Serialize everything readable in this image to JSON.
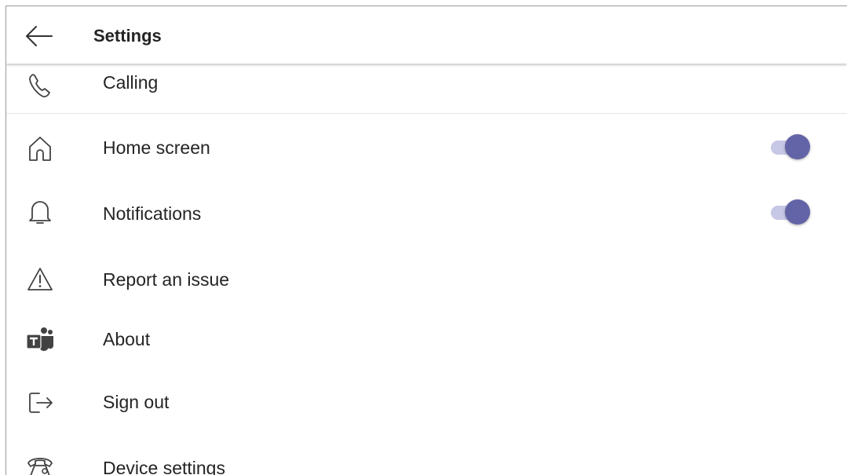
{
  "header": {
    "title": "Settings",
    "back_icon": "arrow-left-icon"
  },
  "items": [
    {
      "label": "Calling",
      "icon": "phone-icon"
    },
    {
      "label": "Home screen",
      "icon": "home-icon",
      "toggle_on": true
    },
    {
      "label": "Notifications",
      "icon": "bell-icon",
      "toggle_on": true
    },
    {
      "label": "Report an issue",
      "icon": "warning-icon"
    },
    {
      "label": "About",
      "icon": "teams-logo-icon"
    },
    {
      "label": "Sign out",
      "icon": "sign-out-icon"
    },
    {
      "label": "Device settings",
      "icon": "desk-phone-icon"
    }
  ],
  "colors": {
    "accent": "#6264a7",
    "toggle_track": "#c7c8e6",
    "text": "#242424"
  }
}
